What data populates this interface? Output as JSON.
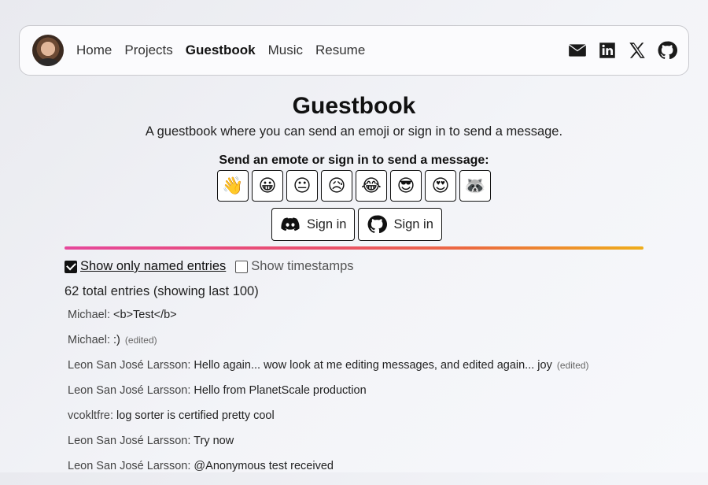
{
  "nav": {
    "links": [
      {
        "label": "Home",
        "active": false
      },
      {
        "label": "Projects",
        "active": false
      },
      {
        "label": "Guestbook",
        "active": true
      },
      {
        "label": "Music",
        "active": false
      },
      {
        "label": "Resume",
        "active": false
      }
    ],
    "socials": [
      "mail-icon",
      "linkedin-icon",
      "x-icon",
      "github-icon"
    ]
  },
  "page": {
    "title": "Guestbook",
    "subtitle": "A guestbook where you can send an emoji or sign in to send a message."
  },
  "emotes": {
    "heading": "Send an emote or sign in to send a message:",
    "items": [
      "👋",
      "😀",
      "😐",
      "😥",
      "😂",
      "😎",
      "😍",
      "🦝"
    ]
  },
  "signin": {
    "discord_label": "Sign in",
    "github_label": "Sign in"
  },
  "filters": {
    "named_label": "Show only named entries",
    "named_checked": true,
    "timestamps_label": "Show timestamps",
    "timestamps_checked": false
  },
  "count_text": "62 total entries (showing last 100)",
  "entries": [
    {
      "author": "Michael:",
      "message": "<b>Test</b>",
      "edited": ""
    },
    {
      "author": "Michael:",
      "message": ":)",
      "edited": "(edited)"
    },
    {
      "author": "Leon San José Larsson:",
      "message": "Hello again... wow look at me editing messages, and edited again... joy",
      "edited": "(edited)"
    },
    {
      "author": "Leon San José Larsson:",
      "message": "Hello from PlanetScale production",
      "edited": ""
    },
    {
      "author": "vcokltfre:",
      "message": "log sorter is certified pretty cool",
      "edited": ""
    },
    {
      "author": "Leon San José Larsson:",
      "message": "Try now",
      "edited": ""
    },
    {
      "author": "Leon San José Larsson:",
      "message": "@Anonymous test received",
      "edited": ""
    }
  ]
}
